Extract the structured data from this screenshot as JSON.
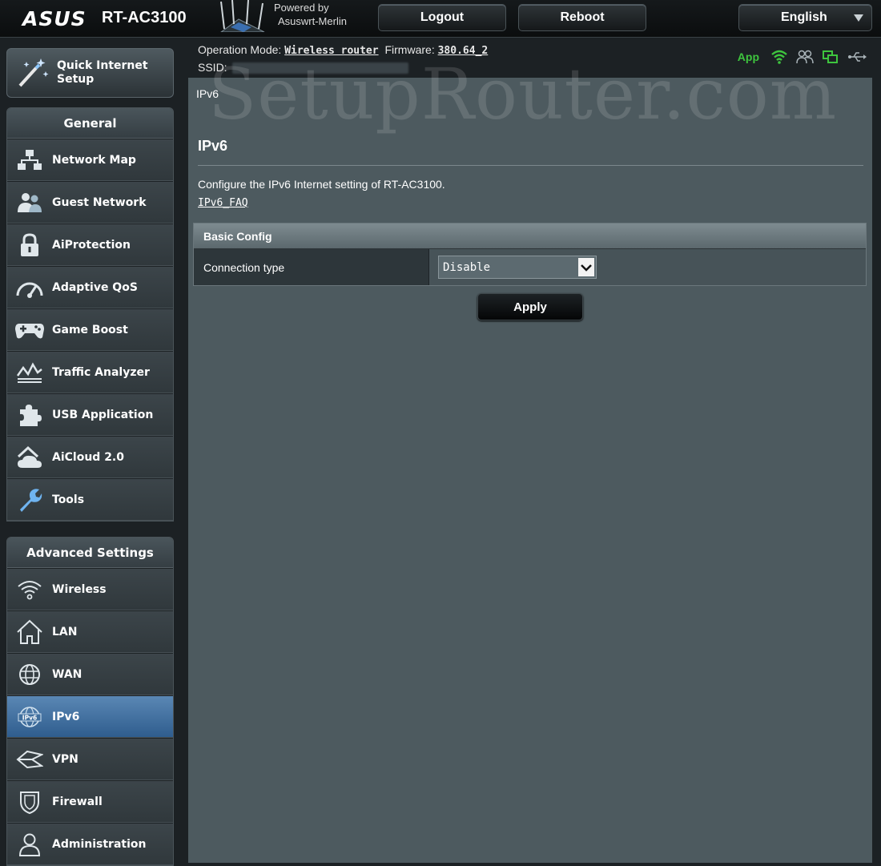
{
  "header": {
    "brand": "ASUS",
    "model": "RT-AC3100",
    "powered_by_line1": "Powered by",
    "powered_by_line2": "Asuswrt-Merlin",
    "logout_label": "Logout",
    "reboot_label": "Reboot",
    "language_label": "English"
  },
  "status": {
    "operation_mode_label": "Operation Mode:",
    "operation_mode_value": "Wireless router",
    "firmware_label": "Firmware:",
    "firmware_value": "380.64_2",
    "ssid_label": "SSID:",
    "app_label": "App"
  },
  "sidebar": {
    "quick_setup_line1": "Quick Internet",
    "quick_setup_line2": "Setup",
    "general_title": "General",
    "general_items": [
      {
        "label": "Network Map",
        "icon": "network-map-icon"
      },
      {
        "label": "Guest Network",
        "icon": "guest-network-icon"
      },
      {
        "label": "AiProtection",
        "icon": "lock-icon"
      },
      {
        "label": "Adaptive QoS",
        "icon": "speedometer-icon"
      },
      {
        "label": "Game Boost",
        "icon": "gamepad-icon"
      },
      {
        "label": "Traffic Analyzer",
        "icon": "traffic-chart-icon"
      },
      {
        "label": "USB Application",
        "icon": "puzzle-icon"
      },
      {
        "label": "AiCloud 2.0",
        "icon": "cloud-house-icon"
      },
      {
        "label": "Tools",
        "icon": "wrench-icon"
      }
    ],
    "advanced_title": "Advanced Settings",
    "advanced_items": [
      {
        "label": "Wireless",
        "icon": "wifi-icon"
      },
      {
        "label": "LAN",
        "icon": "house-icon"
      },
      {
        "label": "WAN",
        "icon": "globe-icon"
      },
      {
        "label": "IPv6",
        "icon": "ipv6-globe-icon",
        "active": true
      },
      {
        "label": "VPN",
        "icon": "vpn-icon"
      },
      {
        "label": "Firewall",
        "icon": "shield-icon"
      },
      {
        "label": "Administration",
        "icon": "person-icon"
      }
    ]
  },
  "main": {
    "tab_label": "IPv6",
    "title": "IPv6",
    "description": "Configure the IPv6 Internet setting of RT-AC3100.",
    "faq_link": "IPv6_FAQ",
    "section_title": "Basic Config",
    "connection_type_label": "Connection type",
    "connection_type_value": "Disable",
    "apply_label": "Apply"
  },
  "watermark": "SetupRouter.com",
  "colors": {
    "accent_active": "#3a6a9b",
    "status_green": "#3ec53e",
    "content_bg": "#4d5a5f"
  }
}
